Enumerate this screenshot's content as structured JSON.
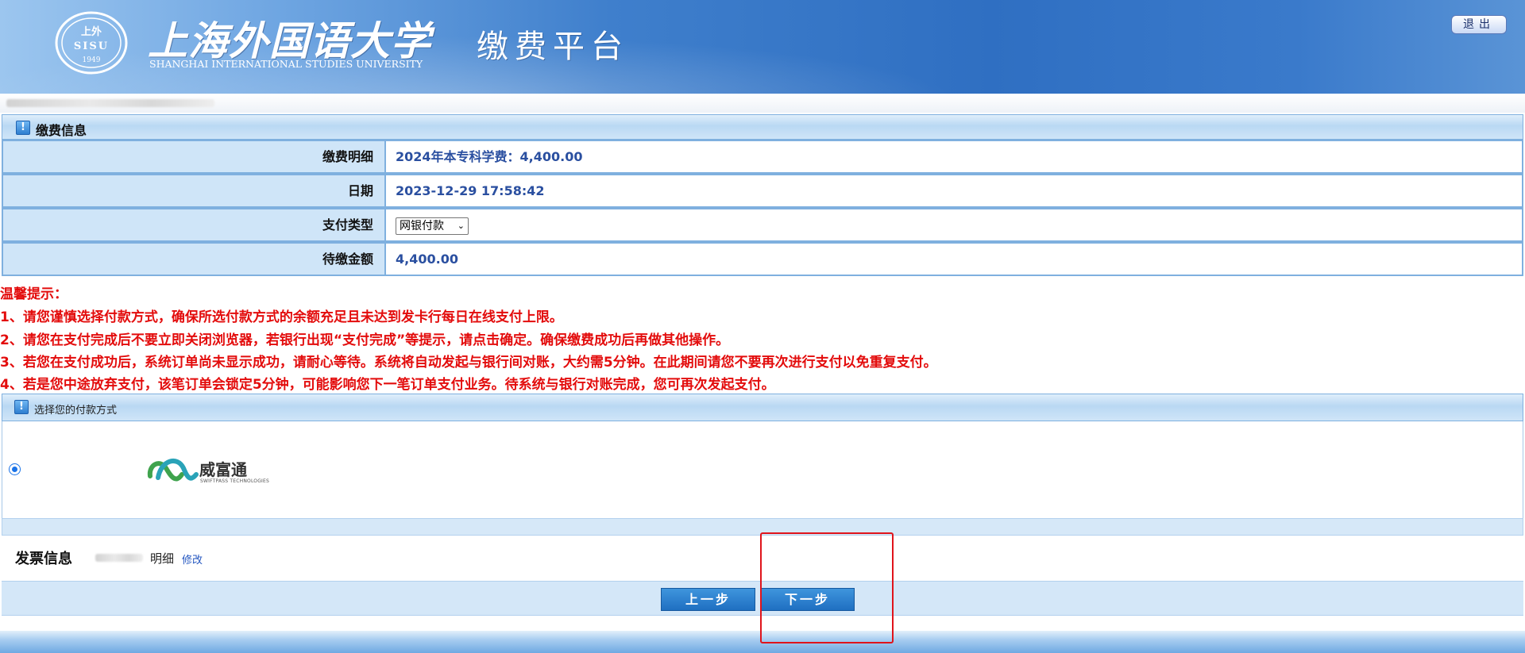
{
  "header": {
    "university_cn": "上海外国语大学",
    "university_en": "SHANGHAI INTERNATIONAL STUDIES UNIVERSITY",
    "seal_text_top": "上外",
    "seal_text_mid": "SISU",
    "seal_year": "1949",
    "platform_title": "缴费平台",
    "logout_label": "退出"
  },
  "payment_info": {
    "section_title": "缴费信息",
    "rows": [
      {
        "label": "缴费明细",
        "value": "2024年本专科学费：4,400.00"
      },
      {
        "label": "日期",
        "value": "2023-12-29 17:58:42"
      },
      {
        "label": "支付类型",
        "value": ""
      },
      {
        "label": "待缴金额",
        "value": "4,400.00"
      }
    ],
    "payment_type_selected": "网银付款"
  },
  "tips": [
    "温馨提示：",
    "1、请您谨慎选择付款方式，确保所选付款方式的余额充足且未达到发卡行每日在线支付上限。",
    "2、请您在支付完成后不要立即关闭浏览器，若银行出现“支付完成”等提示，请点击确定。确保缴费成功后再做其他操作。",
    "3、若您在支付成功后，系统订单尚未显示成功，请耐心等待。系统将自动发起与银行间对账，大约需5分钟。在此期间请您不要再次进行支付以免重复支付。",
    "4、若是您中途放弃支付，该笔订单会锁定5分钟，可能影响您下一笔订单支付业务。待系统与银行对账完成，您可再次发起支付。"
  ],
  "payment_method": {
    "section_title": "选择您的付款方式",
    "option_name": "威富通",
    "option_subtitle": "SWIFTPASS TECHNOLOGIES"
  },
  "invoice": {
    "title": "发票信息",
    "detail": "明细",
    "edit_label": "修改"
  },
  "buttons": {
    "prev_label": "上一步",
    "next_label": "下一步"
  },
  "colors": {
    "header_blue": "#2f6fc2",
    "section_blue": "#cfe5f8",
    "border_blue": "#7fb0df",
    "value_text": "#2a4fa0",
    "tip_red": "#e30c0c",
    "button_blue": "#1f6fc1",
    "highlight_red": "#e0141b"
  }
}
